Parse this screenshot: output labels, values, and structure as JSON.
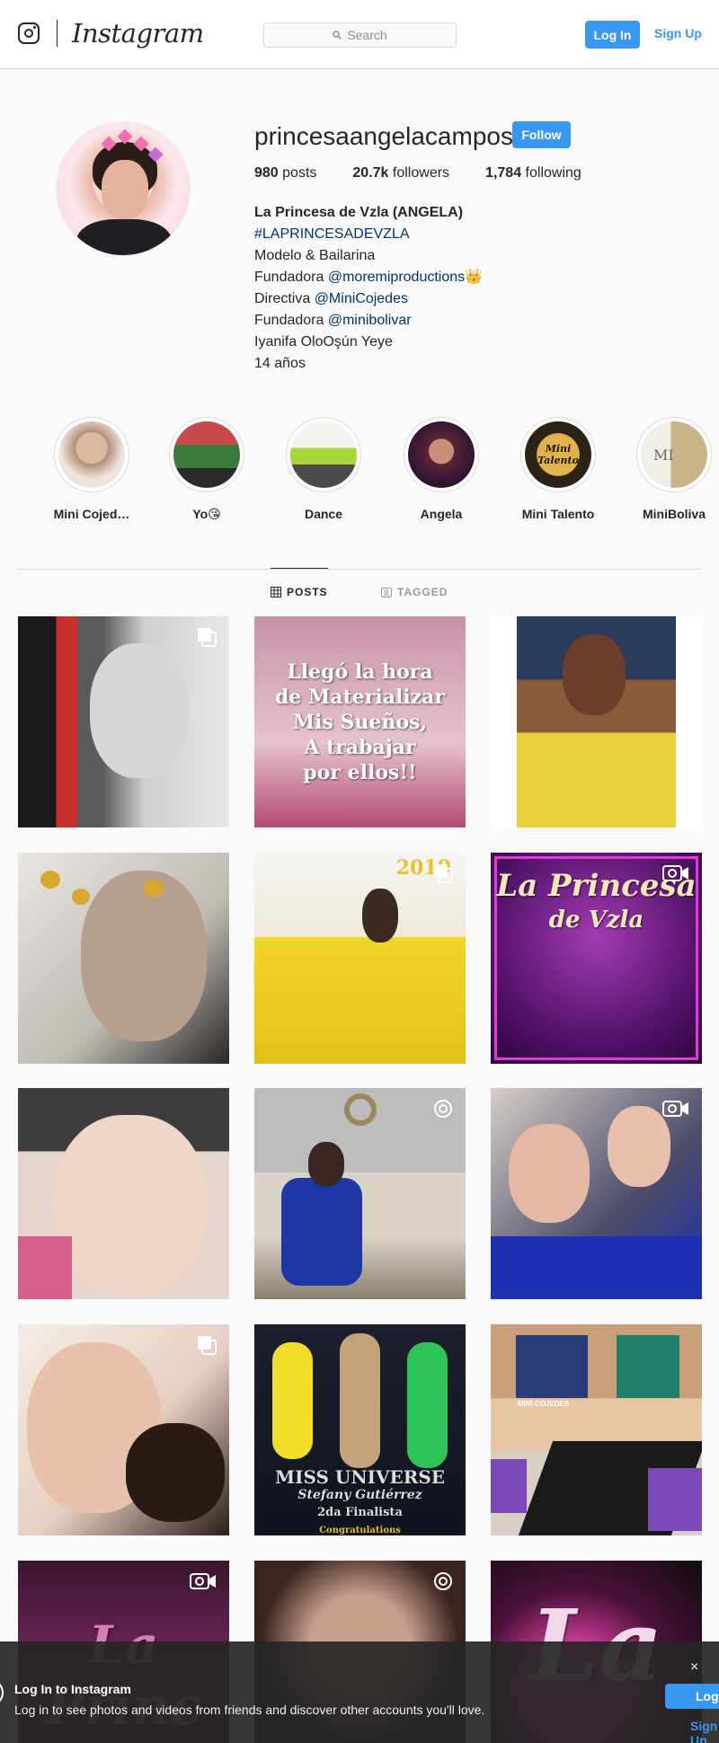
{
  "header": {
    "wordmark": "Instagram",
    "search_placeholder": "Search",
    "login_label": "Log In",
    "signup_label": "Sign Up"
  },
  "profile": {
    "username": "princesaangelacampos",
    "follow_label": "Follow",
    "stats": {
      "posts_count": "980",
      "posts_label": "posts",
      "followers_count": "20.7k",
      "followers_label": "followers",
      "following_count": "1,784",
      "following_label": "following"
    },
    "bio": {
      "full_name": "La Princesa de Vzla (ANGELA)",
      "hashtag": "#LAPRINCESADEVZLA",
      "line1": "Modelo & Bailarina",
      "fundadora1_prefix": "Fundadora ",
      "fundadora1_link": "@moremiproductions",
      "fundadora1_emoji": "👑",
      "directiva_prefix": "Directiva ",
      "directiva_link": "@MiniCojedes",
      "fundadora2_prefix": "Fundadora ",
      "fundadora2_link": "@minibolivar",
      "line_iyanifa": "Iyanifa OloOşún Yeye",
      "line_age": "14 años"
    }
  },
  "highlights": [
    {
      "label": "Mini Cojed…"
    },
    {
      "label": "Yo😘"
    },
    {
      "label": "Dance"
    },
    {
      "label": "Angela"
    },
    {
      "label": "Mini Talento"
    },
    {
      "label": "MiniBoliva"
    }
  ],
  "highlight_texts": {
    "mini_talento_logo": "Mini Talento",
    "miniboliva_logo": "MI"
  },
  "tabs": {
    "posts": "POSTS",
    "tagged": "TAGGED"
  },
  "posts": {
    "p2_text_1": "Llegó la hora",
    "p2_text_2": "de Materializar",
    "p2_text_3": "Mis Sueños,",
    "p2_text_4": "A trabajar",
    "p2_text_5": "por ellos!!",
    "p5_year": "2019",
    "p6_title_1": "La Princesa",
    "p6_title_2": "de Vzla",
    "p11_line1": "MISS UNIVERSE",
    "p11_line2": "Stefany Gutiérrez",
    "p11_line3": "2da Finalista",
    "p11_line4": "Congratulations",
    "p12_sign": "MINI COJEDES",
    "p13_text": "La Princ",
    "p15_text": "La"
  },
  "banner": {
    "title": "Log In to Instagram",
    "subtitle": "Log in to see photos and videos from friends and discover other accounts you'll love.",
    "close": "×",
    "login": "Log In",
    "signup": "Sign Up"
  }
}
